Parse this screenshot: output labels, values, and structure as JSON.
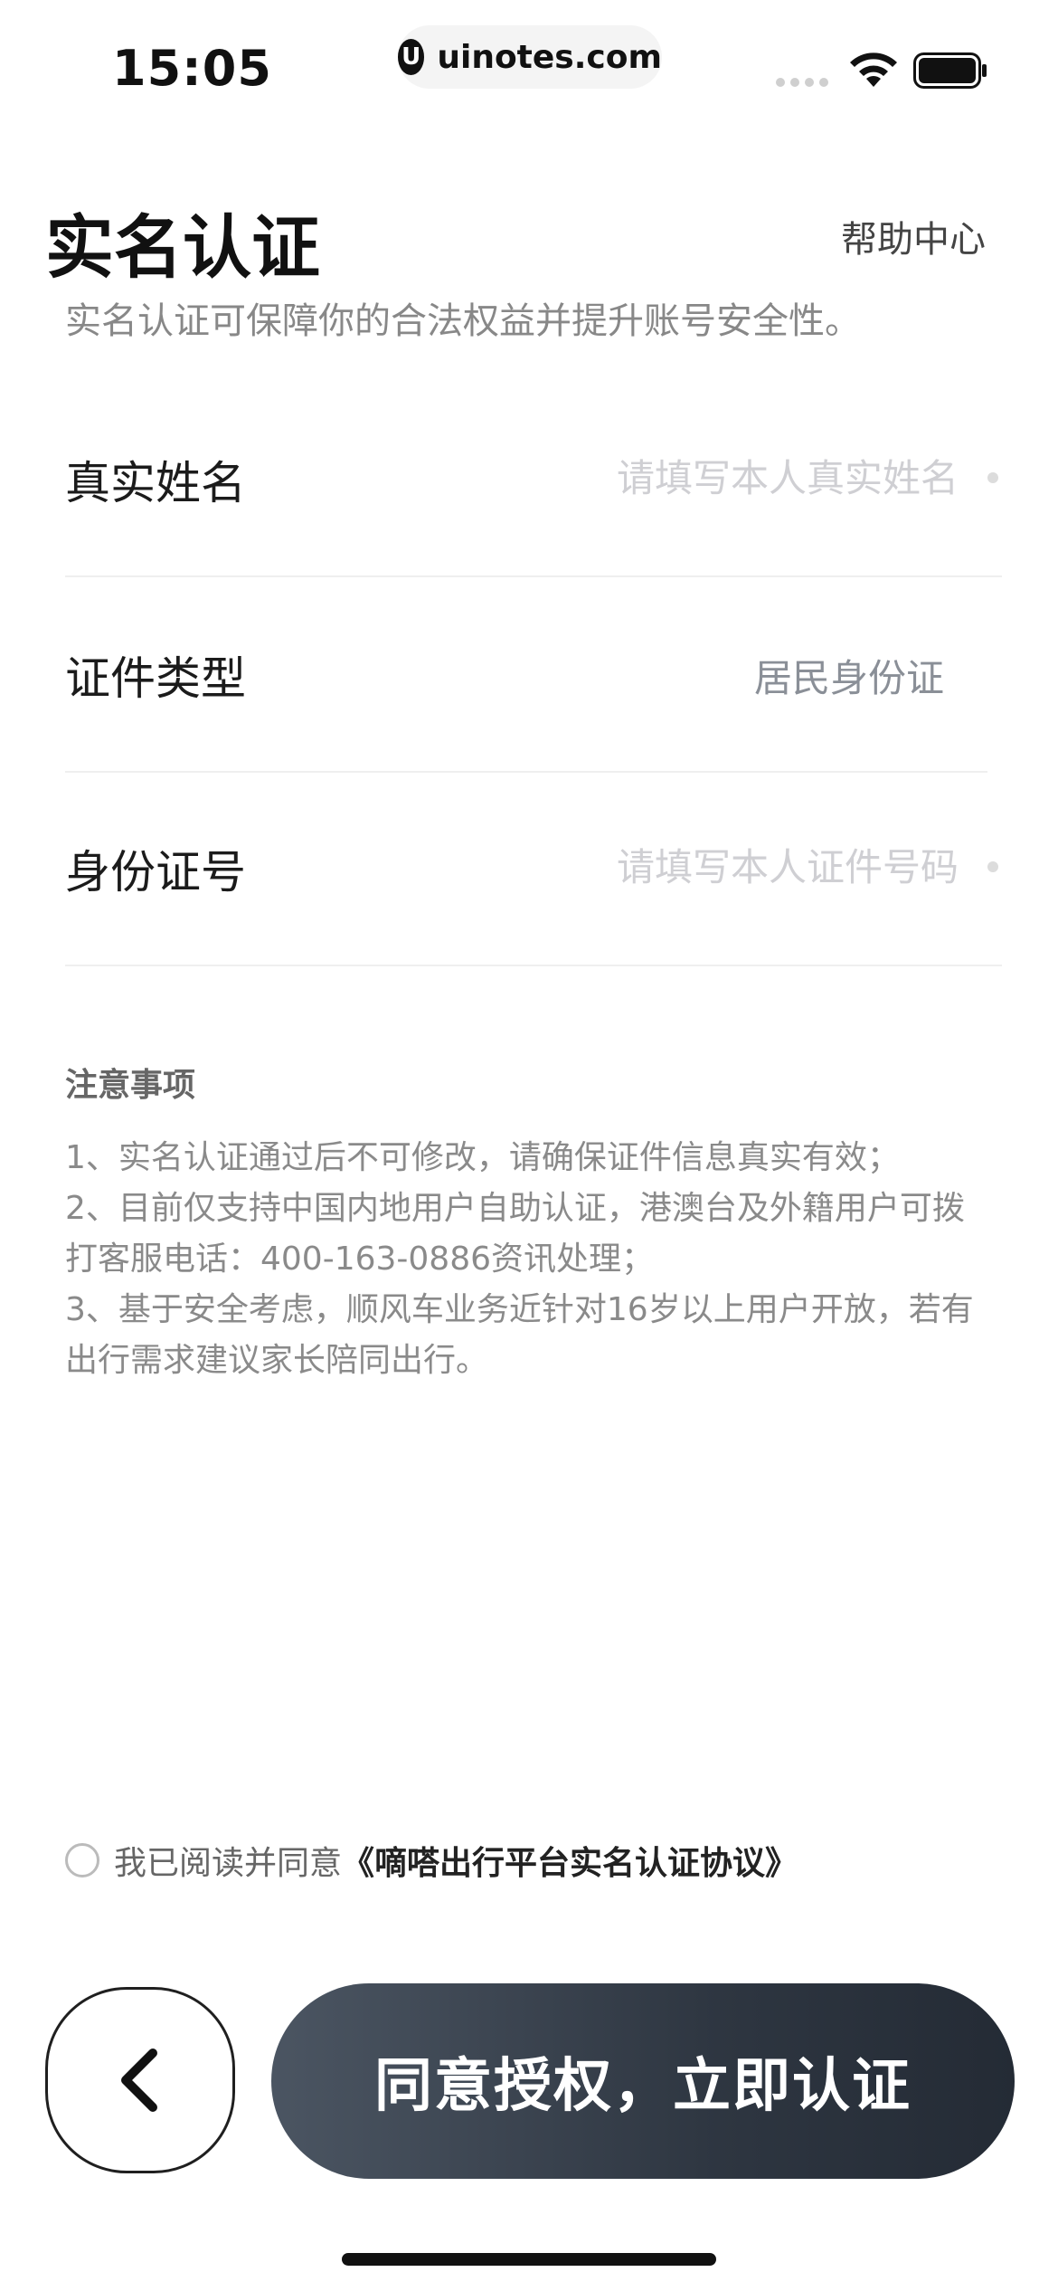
{
  "status_bar": {
    "time": "15:05",
    "url": "uinotes.com",
    "logo_glyph": "U"
  },
  "header": {
    "title": "实名认证",
    "help_link": "帮助中心",
    "subtitle": "实名认证可保障你的合法权益并提升账号安全性。"
  },
  "form": {
    "name": {
      "label": "真实姓名",
      "placeholder": "请填写本人真实姓名",
      "value": ""
    },
    "id_type": {
      "label": "证件类型",
      "value": "居民身份证"
    },
    "id_number": {
      "label": "身份证号",
      "placeholder": "请填写本人证件号码",
      "value": ""
    }
  },
  "notes": {
    "title": "注意事项",
    "items": [
      "1、实名认证通过后不可修改，请确保证件信息真实有效；",
      "2、目前仅支持中国内地用户自助认证，港澳台及外籍用户可拨打客服电话：400-163-0886资讯处理；",
      "3、基于安全考虑，顺风车业务近针对16岁以上用户开放，若有出行需求建议家长陪同出行。"
    ]
  },
  "agreement": {
    "checked": false,
    "prefix": "我已阅读并同意",
    "link": "《嘀嗒出行平台实名认证协议》"
  },
  "actions": {
    "submit_label": "同意授权，立即认证"
  },
  "colors": {
    "cta_gradient_start": "#4b5562",
    "cta_gradient_end": "#242b35",
    "placeholder": "#cfcfd3"
  }
}
